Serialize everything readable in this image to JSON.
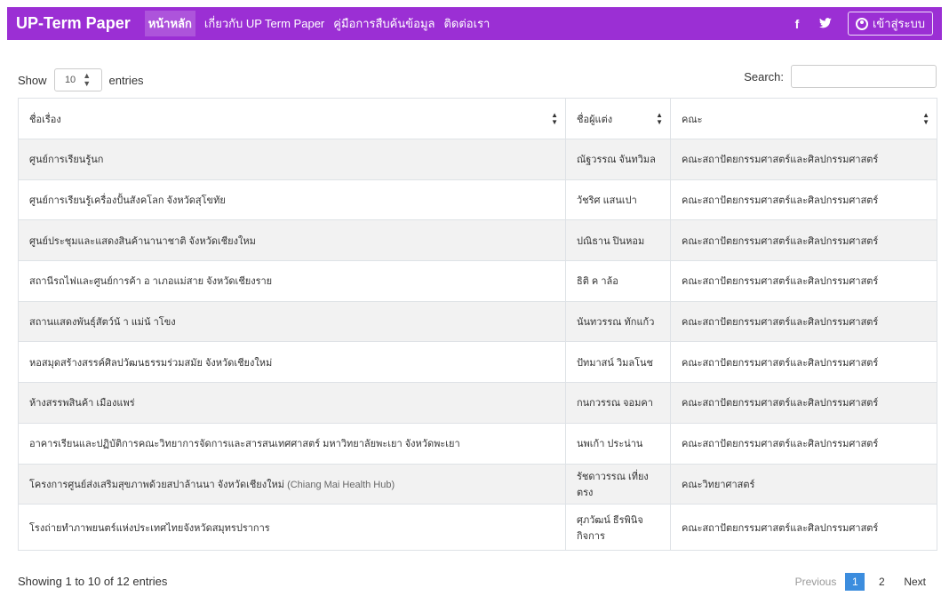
{
  "navbar": {
    "brand": "UP-Term Paper",
    "links": [
      {
        "label": "หน้าหลัก",
        "active": true
      },
      {
        "label": "เกี่ยวกับ UP Term Paper",
        "active": false
      },
      {
        "label": "คู่มือการสืบค้นข้อมูล",
        "active": false
      },
      {
        "label": "ติดต่อเรา",
        "active": false
      }
    ],
    "facebook_glyph": "f",
    "twitter_glyph": "🐦",
    "login_label": "เข้าสู่ระบบ"
  },
  "controls": {
    "show_label": "Show",
    "length_value": "10",
    "entries_label": "entries",
    "search_label": "Search:",
    "search_value": ""
  },
  "table": {
    "columns": [
      "ชื่อเรื่อง",
      "ชื่อผู้แต่ง",
      "คณะ"
    ],
    "rows": [
      {
        "title": "ศูนย์การเรียนรู้นก",
        "title_sub": "",
        "author": "ณัฐวรรณ จันทวิมล",
        "faculty": "คณะสถาปัตยกรรมศาสตร์และศิลปกรรมศาสตร์"
      },
      {
        "title": "ศูนย์การเรียนรู้เครื่องปั้นสังคโลก จังหวัดสุโขทัย",
        "title_sub": "",
        "author": "วัชริศ แสนเปา",
        "faculty": "คณะสถาปัตยกรรมศาสตร์และศิลปกรรมศาสตร์"
      },
      {
        "title": "ศูนย์ประชุมและแสดงสินค้านานาชาติ จังหวัดเชียงใหม",
        "title_sub": "",
        "author": "ปณิธาน ปินหอม",
        "faculty": "คณะสถาปัตยกรรมศาสตร์และศิลปกรรมศาสตร์"
      },
      {
        "title": "สถานีรถไฟและศูนย์การค้า อ าเภอแม่สาย จังหวัดเชียงราย",
        "title_sub": "",
        "author": "ธิติ ค าล้อ",
        "faculty": "คณะสถาปัตยกรรมศาสตร์และศิลปกรรมศาสตร์"
      },
      {
        "title": "สถานแสดงพันธุ์สัตว์น้ า แม่น้ าโขง",
        "title_sub": "",
        "author": "นันทวรรณ ทักแก้ว",
        "faculty": "คณะสถาปัตยกรรมศาสตร์และศิลปกรรมศาสตร์"
      },
      {
        "title": "หอสมุดสร้างสรรค์ศิลปวัฒนธรรมร่วมสมัย จังหวัดเชียงใหม่",
        "title_sub": "",
        "author": "ปัทมาสน์ วิมลโนช",
        "faculty": "คณะสถาปัตยกรรมศาสตร์และศิลปกรรมศาสตร์"
      },
      {
        "title": "ห้างสรรพสินค้า เมืองแพร่",
        "title_sub": "",
        "author": "กนกวรรณ จอมคา",
        "faculty": "คณะสถาปัตยกรรมศาสตร์และศิลปกรรมศาสตร์"
      },
      {
        "title": "อาคารเรียนและปฏิบัติการคณะวิทยาการจัดการและสารสนเทศศาสตร์ มหาวิทยาลัยพะเยา จังหวัดพะเยา",
        "title_sub": "",
        "author": "นพเก้า ประน่าน",
        "faculty": "คณะสถาปัตยกรรมศาสตร์และศิลปกรรมศาสตร์"
      },
      {
        "title": "โครงการศูนย์ส่งเสริมสุขภาพด้วยสปาล้านนา จังหวัดเชียงใหม่",
        "title_sub": "(Chiang Mai Health Hub)",
        "author": "รัชดาวรรณ เที่ยงตรง",
        "faculty": "คณะวิทยาศาสตร์"
      },
      {
        "title": "โรงถ่ายทำภาพยนตร์แห่งประเทศไทยจังหวัดสมุทรปราการ",
        "title_sub": "",
        "author": "ศุภวัฒน์ ธีรพินิจกิจการ",
        "faculty": "คณะสถาปัตยกรรมศาสตร์และศิลปกรรมศาสตร์"
      }
    ]
  },
  "footer": {
    "info": "Showing 1 to 10 of 12 entries",
    "prev": "Previous",
    "pages": [
      "1",
      "2"
    ],
    "current_page": "1",
    "next": "Next"
  },
  "colors": {
    "navbar": "#9b2fd4",
    "pager_active": "#3c8dde",
    "row_stripe": "#f2f2f2"
  }
}
